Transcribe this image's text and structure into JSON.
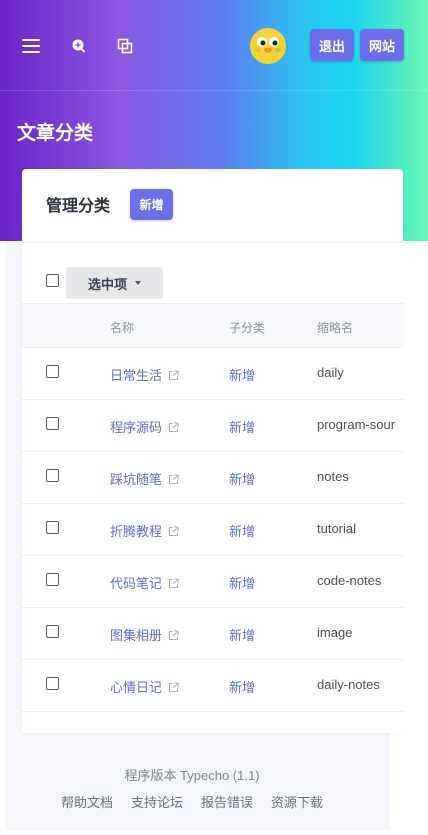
{
  "header": {
    "logout_label": "退出",
    "site_label": "网站",
    "icons": [
      "menu-icon",
      "zoom-in-icon",
      "windows-icon"
    ],
    "gradient": [
      "#6a23c6",
      "#8a58e0",
      "#27c7ef",
      "#6df6b1"
    ]
  },
  "page": {
    "title": "文章分类"
  },
  "card": {
    "title": "管理分类",
    "new_label": "新增",
    "select_label": "选中项",
    "columns": {
      "name": "名称",
      "sub": "子分类",
      "slug": "缩略名"
    },
    "rows": [
      {
        "name": "日常生活",
        "sub": "新增",
        "slug": "daily"
      },
      {
        "name": "程序源码",
        "sub": "新增",
        "slug": "program-sour"
      },
      {
        "name": "踩坑随笔",
        "sub": "新增",
        "slug": "notes"
      },
      {
        "name": "折腾教程",
        "sub": "新增",
        "slug": "tutorial"
      },
      {
        "name": "代码笔记",
        "sub": "新增",
        "slug": "code-notes"
      },
      {
        "name": "图集相册",
        "sub": "新增",
        "slug": "image"
      },
      {
        "name": "心情日记",
        "sub": "新增",
        "slug": "daily-notes"
      }
    ]
  },
  "footer": {
    "version": "程序版本 Typecho (1.1)",
    "links": [
      "帮助文档",
      "支持论坛",
      "报告错误",
      "资源下载"
    ]
  },
  "colors": {
    "accent": "#6a6ee8",
    "link": "#5a6ed5",
    "background": "#f4f6fb"
  }
}
